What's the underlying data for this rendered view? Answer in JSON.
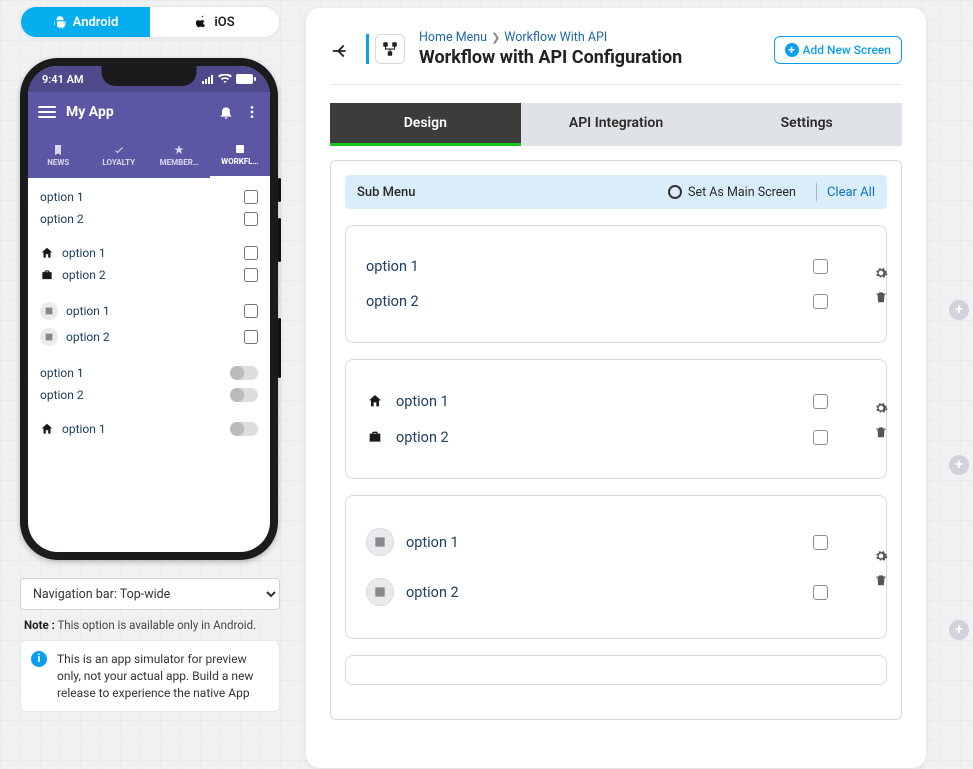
{
  "platform": {
    "android": "Android",
    "ios": "iOS"
  },
  "phone": {
    "time": "9:41 AM",
    "app_name": "My App",
    "tabs": [
      "NEWS",
      "LOYALTY",
      "MEMBER…",
      "WORKFL…"
    ],
    "rows": {
      "g1o1": "option 1",
      "g1o2": "option 2",
      "g2o1": "option 1",
      "g2o2": "option 2",
      "g3o1": "option 1",
      "g3o2": "option 2",
      "g4o1": "option 1",
      "g4o2": "option 2",
      "g5o1": "option 1"
    }
  },
  "nav_select": "Navigation bar: Top-wide",
  "note_label": "Note :",
  "note_text": " This option is available only in Android.",
  "info_text": "This is an app simulator for preview only, not your actual app. Build a new release to experience the native App",
  "breadcrumb": {
    "a": "Home Menu",
    "b": "Workflow With API"
  },
  "page_title": "Workflow with API Configuration",
  "add_screen": "Add New Screen",
  "tabs": {
    "design": "Design",
    "api": "API Integration",
    "settings": "Settings"
  },
  "submenu": {
    "label": "Sub Menu",
    "set_main": "Set As Main Screen",
    "clear": "Clear All"
  },
  "cards": {
    "c1": {
      "o1": "option 1",
      "o2": "option 2"
    },
    "c2": {
      "o1": "option 1",
      "o2": "option 2"
    },
    "c3": {
      "o1": "option 1",
      "o2": "option 2"
    }
  }
}
